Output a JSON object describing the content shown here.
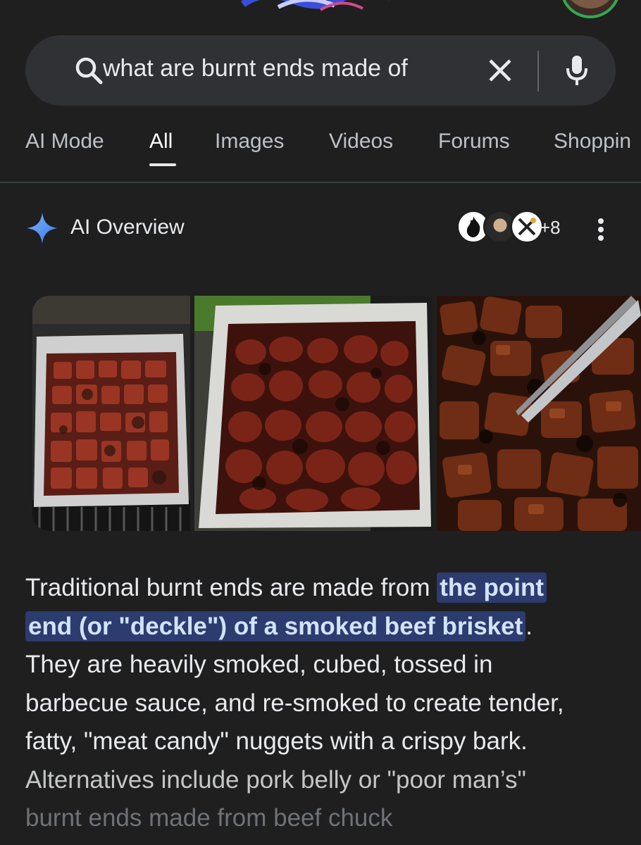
{
  "search": {
    "query": "what are burnt ends made of"
  },
  "tabs": [
    {
      "label": "AI Mode"
    },
    {
      "label": "All"
    },
    {
      "label": "Images"
    },
    {
      "label": "Videos"
    },
    {
      "label": "Forums"
    },
    {
      "label": "Shoppin"
    }
  ],
  "active_tab": "All",
  "ai_overview": {
    "title": "AI Overview",
    "source_count": "+8",
    "text_before": "Traditional burnt ends are made from ",
    "highlight_line1": "the point",
    "highlight_line2": "end (or \"deckle\") of a smoked beef brisket",
    "text_after": ".",
    "line3": "They are heavily smoked, cubed, tossed in",
    "line4": "barbecue sauce, and re-smoked to create tender,",
    "line5": "fatty, \"meat candy\" nuggets with a crispy bark.",
    "line6": "Alternatives include pork belly or \"poor man’s\"",
    "line7": "burnt ends made from beef chuck"
  },
  "images": [
    {
      "alt": "burnt ends in foil pan on grill"
    },
    {
      "alt": "sauced burnt ends in foil pan"
    },
    {
      "alt": "close-up of burnt ends with tongs"
    }
  ],
  "icons": {
    "search": "search-icon",
    "clear": "close-icon",
    "mic": "microphone-icon",
    "sparkle": "sparkle-icon",
    "more": "more-vertical-icon"
  },
  "colors": {
    "background": "#1f1f1f",
    "search_bar": "#303134",
    "highlight": "#2c3c6e",
    "sparkle": "#4c8df6"
  }
}
